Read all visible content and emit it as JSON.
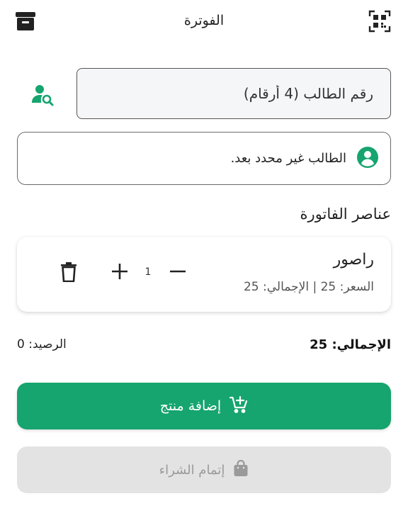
{
  "header": {
    "title": "الفوترة",
    "left_icon": "archive-icon",
    "right_icon": "qr-scan-icon"
  },
  "student_search": {
    "placeholder": "رقم الطالب (4 أرقام)",
    "value": "",
    "button_icon": "person-search-icon"
  },
  "student_status": {
    "icon": "account-circle-icon",
    "text": "الطالب غير محدد بعد."
  },
  "invoice_items_title": "عناصر الفاتورة",
  "items": [
    {
      "name": "راصور",
      "meta": "السعر: 25 | الإجمالي: 25",
      "quantity": "1"
    }
  ],
  "totals": {
    "total": "الإجمالي: 25",
    "balance": "الرصيد: 0"
  },
  "add_product_button": {
    "label": "إضافة منتج",
    "icon": "add-cart-icon"
  },
  "complete_purchase_button": {
    "label": "إتمام الشراء",
    "icon": "shopping-bag-icon",
    "enabled": false
  },
  "colors": {
    "accent": "#16a46f",
    "disabled_bg": "#e3e3e3",
    "disabled_text": "#9a9a9a"
  }
}
